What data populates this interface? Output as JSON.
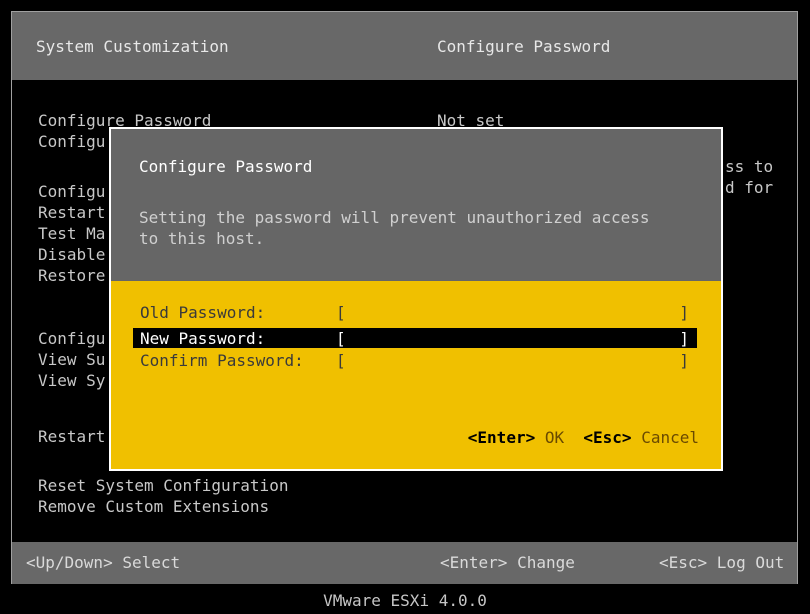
{
  "header": {
    "left_title": "System Customization",
    "right_title": "Configure Password"
  },
  "menu": {
    "items": [
      {
        "label": "Configure Password"
      },
      {
        "label": "Configu"
      },
      {
        "label": "Configu"
      },
      {
        "label": "Restart"
      },
      {
        "label": "Test Ma"
      },
      {
        "label": "Disable"
      },
      {
        "label": "Restore"
      },
      {
        "label": "Configu"
      },
      {
        "label": "View Su"
      },
      {
        "label": "View Sy"
      },
      {
        "label": "Restart"
      },
      {
        "label": "Reset System Configuration"
      },
      {
        "label": "Remove Custom Extensions"
      }
    ]
  },
  "details": {
    "status": "Not set",
    "fragment_line1": "ss to",
    "fragment_line2": "d for"
  },
  "dialog": {
    "title": "Configure Password",
    "description_line1": "Setting the password will prevent unauthorized access",
    "description_line2": "to this host.",
    "fields": [
      {
        "label": "Old Password:",
        "value": "",
        "selected": false
      },
      {
        "label": "New Password:",
        "value": "",
        "selected": true
      },
      {
        "label": "Confirm Password:",
        "value": "",
        "selected": false
      }
    ],
    "bracket_open": "[",
    "bracket_close": "]",
    "ok_key": "<Enter>",
    "ok_label": "OK",
    "cancel_key": "<Esc>",
    "cancel_label": "Cancel"
  },
  "footer": {
    "select_hint": "<Up/Down> Select",
    "change_hint": "<Enter> Change",
    "logout_hint": "<Esc> Log Out"
  },
  "version": "VMware ESXi 4.0.0",
  "colors": {
    "header_gray": "#686868",
    "dialog_yellow": "#f0c000",
    "dialog_head_gray": "#666666"
  }
}
